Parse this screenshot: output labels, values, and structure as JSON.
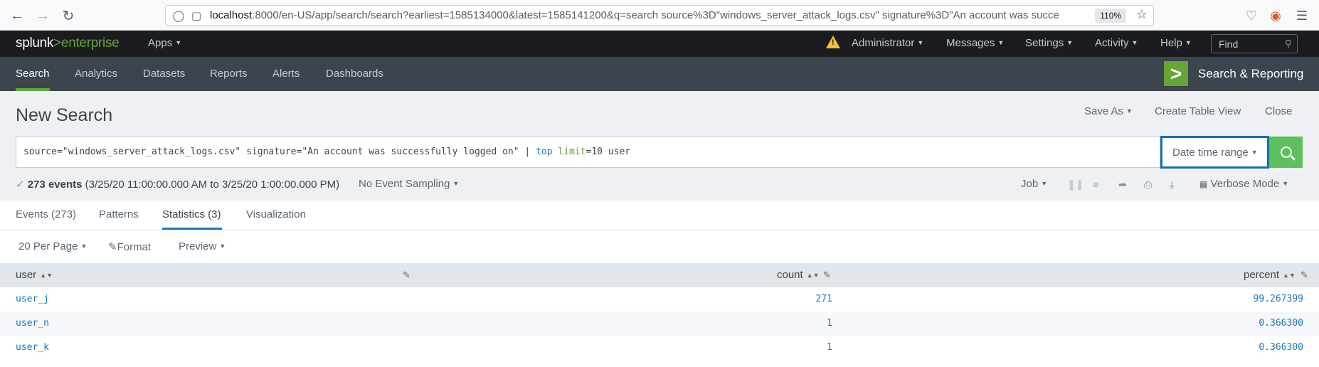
{
  "browser": {
    "url_host": "localhost",
    "url_rest": ":8000/en-US/app/search/search?earliest=1585134000&latest=1585141200&q=search source%3D\"windows_server_attack_logs.csv\" signature%3D\"An account was succe",
    "zoom": "110%"
  },
  "header": {
    "logo_left": "splunk",
    "logo_sep": ">",
    "logo_right": "enterprise",
    "apps": "Apps",
    "user": "Administrator",
    "messages": "Messages",
    "settings": "Settings",
    "activity": "Activity",
    "help": "Help",
    "find_placeholder": "Find"
  },
  "app_nav": {
    "tabs": [
      "Search",
      "Analytics",
      "Datasets",
      "Reports",
      "Alerts",
      "Dashboards"
    ],
    "app_logo": ">",
    "app_title": "Search & Reporting"
  },
  "search": {
    "title": "New Search",
    "save_as": "Save As",
    "create_table_view": "Create Table View",
    "close": "Close",
    "query_prefix": "source=\"windows_server_attack_logs.csv\" signature=\"An account was successfully logged on\" | ",
    "query_cmd": "top",
    "query_arg": "limit",
    "query_suffix": "=10 user",
    "date_range": "Date time range",
    "events_count": "273 events",
    "time_range": "(3/25/20 11:00:00.000 AM to 3/25/20 1:00:00.000 PM)",
    "sampling": "No Event Sampling",
    "job": "Job",
    "mode": "Verbose Mode"
  },
  "result_tabs": [
    "Events (273)",
    "Patterns",
    "Statistics (3)",
    "Visualization"
  ],
  "table_controls": {
    "per_page": "20 Per Page",
    "format": "Format",
    "preview": "Preview"
  },
  "table": {
    "columns": [
      "user",
      "count",
      "percent"
    ],
    "rows": [
      {
        "user": "user_j",
        "count": "271",
        "percent": "99.267399"
      },
      {
        "user": "user_n",
        "count": "1",
        "percent": "0.366300"
      },
      {
        "user": "user_k",
        "count": "1",
        "percent": "0.366300"
      }
    ]
  }
}
